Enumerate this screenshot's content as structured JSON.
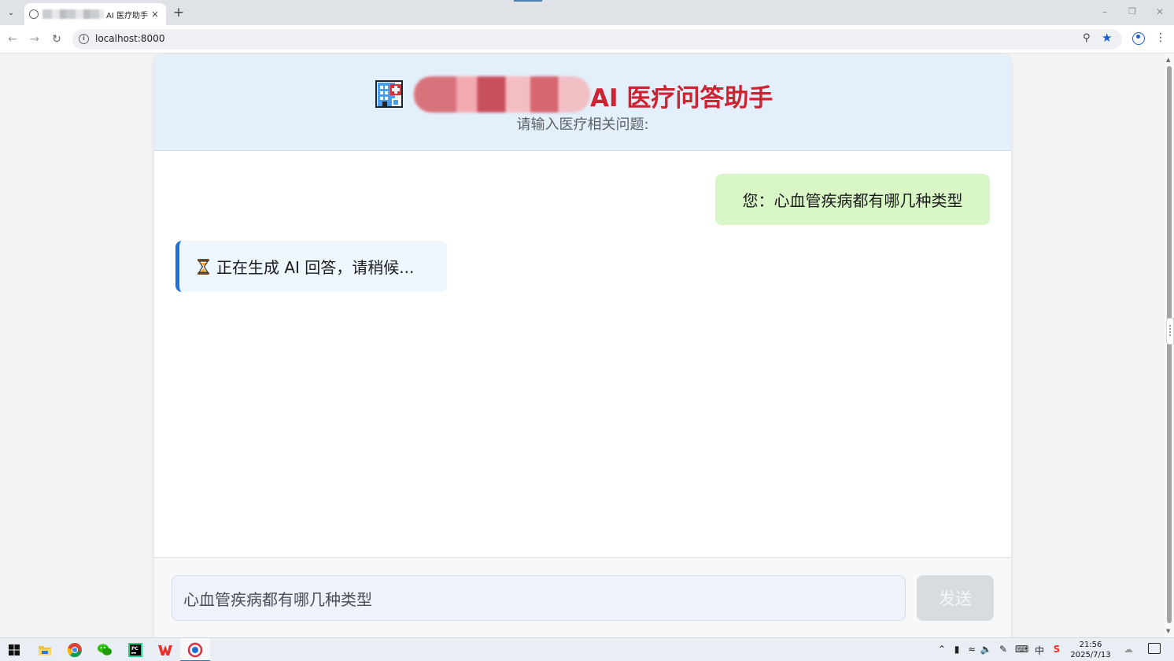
{
  "browser": {
    "tab_title": "AI 医疗助手",
    "url": "localhost:8000",
    "new_tab_label": "+",
    "tab_close_label": "×"
  },
  "header": {
    "title": "AI 医疗问答助手",
    "subtitle": "请输入医疗相关问题:"
  },
  "chat": {
    "messages": [
      {
        "role": "user",
        "text": "您：心血管疾病都有哪几种类型"
      },
      {
        "role": "ai",
        "text": "正在生成 AI 回答，请稍候..."
      }
    ]
  },
  "input": {
    "value": "心血管疾病都有哪几种类型",
    "send_label": "发送"
  },
  "taskbar": {
    "time": "21:56",
    "date": "2025/7/13",
    "ime_label": "中"
  },
  "colors": {
    "title_red": "#cf2331",
    "header_bg": "#e3f0fb",
    "user_bubble": "#d8f6c6",
    "ai_bubble": "#eef6fe",
    "ai_accent": "#1e70d6",
    "send_disabled": "#d9dcdf"
  }
}
